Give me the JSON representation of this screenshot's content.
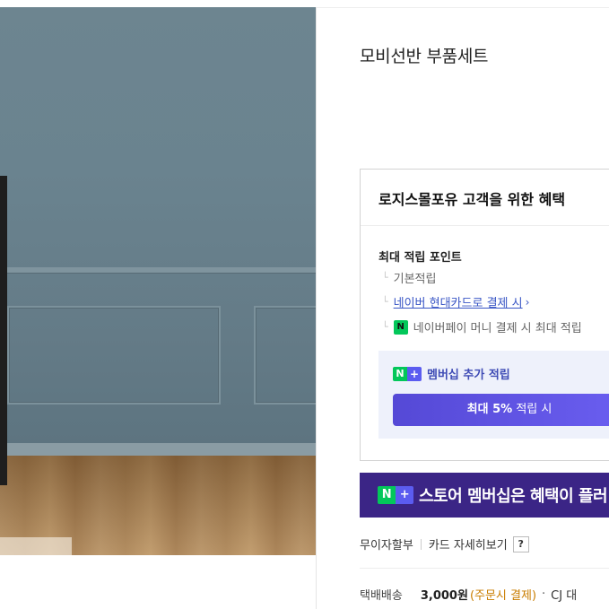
{
  "product": {
    "title": "모비선반 부품세트"
  },
  "benefits": {
    "title": "로지스몰포유 고객을 위한 혜택",
    "max_points_label": "최대 적립 포인트",
    "rows": [
      {
        "text": "기본적립"
      },
      {
        "text": "네이버 현대카드로 결제 시",
        "chevron": "›"
      },
      {
        "badge": "N",
        "text": "네이버페이 머니 결제 시 최대 적립"
      }
    ],
    "membership": {
      "badge_n": "N",
      "badge_plus": "+",
      "label": "멤버십 추가 적립",
      "button_bold": "최대 5%",
      "button_rest": " 적립 시"
    }
  },
  "promo_banner": {
    "badge_n": "N",
    "badge_plus": "+",
    "text": "스토어 멤버십은 혜택이 플러"
  },
  "installment": {
    "label": "무이자할부",
    "card_details": "카드 자세히보기",
    "help": "?"
  },
  "shipping": {
    "label": "택배배송",
    "price": "3,000원",
    "condition": "(주문시 결제)",
    "dot": "·",
    "carrier": "CJ 대"
  }
}
